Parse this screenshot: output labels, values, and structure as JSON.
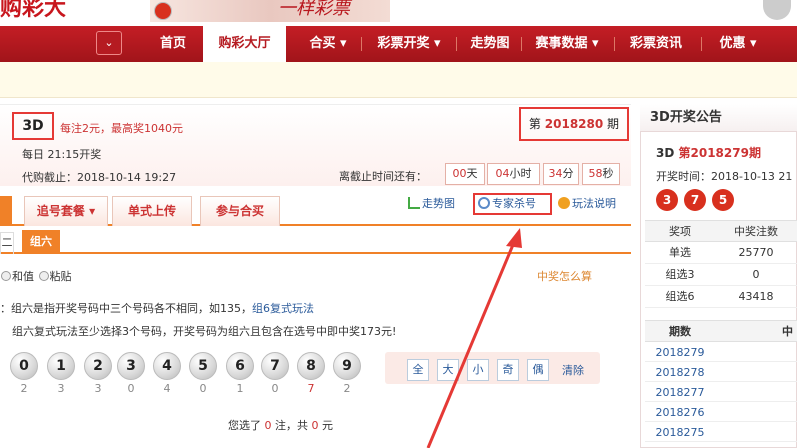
{
  "header": {
    "logo_text": "购彩大",
    "banner_text": "一样彩票",
    "nav_dropdown": "⌄"
  },
  "nav": {
    "items": [
      {
        "label": "首页"
      },
      {
        "label": "购彩大厅"
      },
      {
        "label": "合买 ▾"
      },
      {
        "label": "彩票开奖 ▾"
      },
      {
        "label": "走势图"
      },
      {
        "label": "赛事数据 ▾"
      },
      {
        "label": "彩票资讯"
      },
      {
        "label": "优惠 ▾"
      }
    ]
  },
  "game": {
    "name": "3D",
    "prize_info": "每注2元，最高奖1040元",
    "schedule": "每日 21:15开奖",
    "deadline": "代购截止：2018-10-14 19:27",
    "issue_prefix": "第",
    "issue_number": "2018280",
    "issue_suffix": "期",
    "countdown_label": "离截止时间还有：",
    "countdown": [
      {
        "num": "00",
        "unit": "天"
      },
      {
        "num": "04",
        "unit": "小时"
      },
      {
        "num": "34",
        "unit": "分"
      },
      {
        "num": "58",
        "unit": "秒"
      }
    ]
  },
  "tabs": [
    {
      "label": "追号套餐 ▾"
    },
    {
      "label": "单式上传"
    },
    {
      "label": "参与合买"
    }
  ],
  "links": {
    "trend": "走势图",
    "expert": "专家杀号",
    "rules": "玩法说明"
  },
  "subtabs": {
    "left": "二",
    "active": "组六"
  },
  "options": {
    "opt1": "和值",
    "opt2": "粘贴",
    "howto": "中奖怎么算"
  },
  "desc": {
    "line1_a": "：组六是指开奖号码中三个号码各不相同，如135，",
    "line1_link": "组6复式玩法",
    "line2": "组六复式玩法至少选择3个号码，开奖号码为组六且包含在选号中即中奖173元!"
  },
  "balls": [
    {
      "n": "0",
      "m": "2"
    },
    {
      "n": "1",
      "m": "3"
    },
    {
      "n": "2",
      "m": "3"
    },
    {
      "n": "3",
      "m": "0"
    },
    {
      "n": "4",
      "m": "4"
    },
    {
      "n": "5",
      "m": "0"
    },
    {
      "n": "6",
      "m": "1"
    },
    {
      "n": "7",
      "m": "0"
    },
    {
      "n": "8",
      "m": "7"
    },
    {
      "n": "9",
      "m": "2"
    }
  ],
  "quick": {
    "all": "全",
    "big": "大",
    "small": "小",
    "odd": "奇",
    "even": "偶",
    "clear": "清除"
  },
  "selection": {
    "pre": "您选了",
    "notes": "0",
    "mid": "注，共",
    "amount": "0",
    "post": "元"
  },
  "right": {
    "title": "3D开奖公告",
    "issue_name": "3D",
    "issue": "第2018279期",
    "time": "开奖时间：2018-10-13 21",
    "numbers": [
      "3",
      "7",
      "5"
    ],
    "table_head": [
      "奖项",
      "中奖注数"
    ],
    "table_rows": [
      [
        "单选",
        "25770"
      ],
      [
        "组选3",
        "0"
      ],
      [
        "组选6",
        "43418"
      ]
    ],
    "hist_head": [
      "期数",
      "中"
    ],
    "hist": [
      "2018279",
      "2018278",
      "2018277",
      "2018276",
      "2018275"
    ]
  }
}
